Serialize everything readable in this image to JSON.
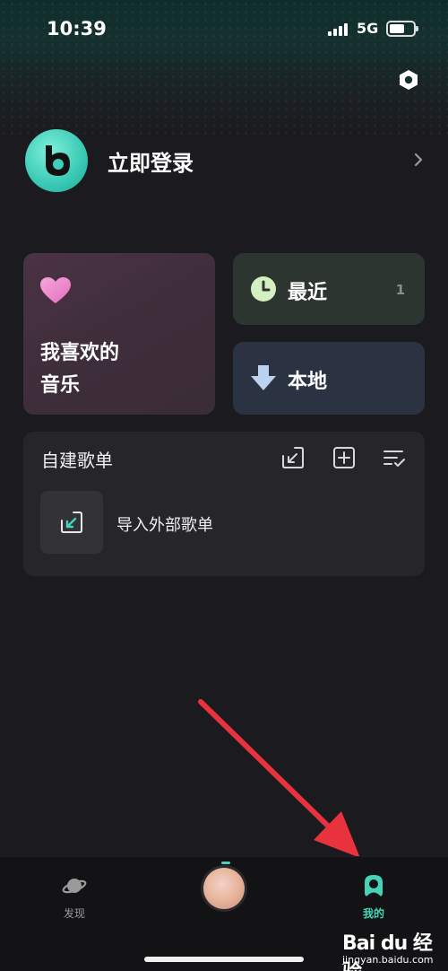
{
  "status_bar": {
    "time": "10:39",
    "network": "5G"
  },
  "profile": {
    "login_label": "立即登录"
  },
  "cards": {
    "favorites": {
      "line1": "我喜欢的",
      "line2": "音乐"
    },
    "recent": {
      "label": "最近",
      "count": "1"
    },
    "local": {
      "label": "本地"
    }
  },
  "playlists": {
    "title": "自建歌单",
    "import_label": "导入外部歌单"
  },
  "tabs": [
    {
      "label": "发现",
      "active": false
    },
    {
      "label": "我的",
      "active": true
    }
  ],
  "watermark": {
    "brand": "Bai du 经验",
    "url": "jingyan.baidu.com"
  },
  "colors": {
    "accent": "#45d4b8",
    "background": "#1b1b1f",
    "annotation_arrow": "#e8333f"
  }
}
